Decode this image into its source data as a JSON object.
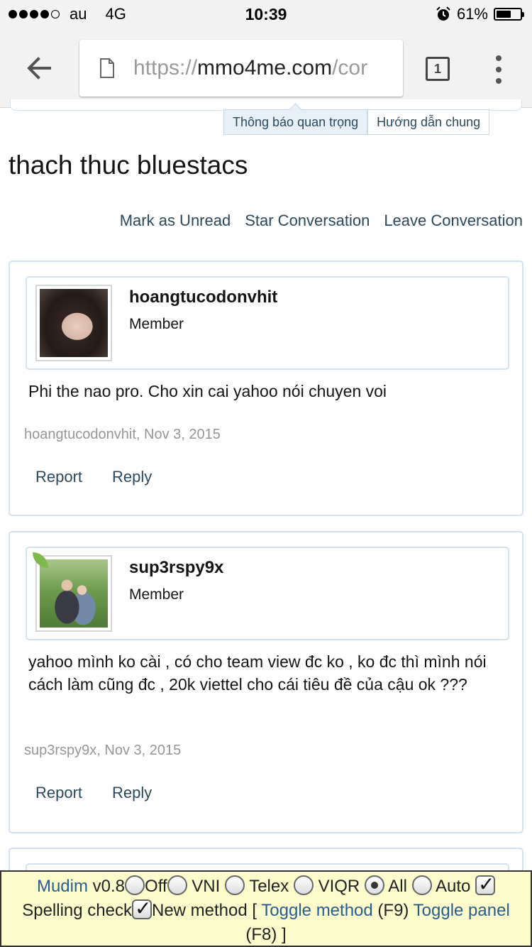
{
  "status_bar": {
    "carrier": "au",
    "network": "4G",
    "time": "10:39",
    "battery": "61%",
    "battery_level": 0.61
  },
  "browser": {
    "url_scheme": "https://",
    "url_domain": "mmo4me.com",
    "url_rest": "/cor",
    "tab_count": "1"
  },
  "subtabs": [
    "Thông báo quan trọng",
    "Hướng dẫn chung"
  ],
  "conversation": {
    "title": "thach thuc bluestacs",
    "actions": [
      "Mark as Unread",
      "Star Conversation",
      "Leave Conversation"
    ]
  },
  "messages": [
    {
      "username": "hoangtucodonvhit",
      "user_title": "Member",
      "text": "Phi the nao pro. Cho xin cai yahoo nói chuyen voi",
      "meta": "hoangtucodonvhit, Nov 3, 2015",
      "report": "Report",
      "reply": "Reply"
    },
    {
      "username": "sup3rspy9x",
      "user_title": "Member",
      "text": "yahoo mình ko cài , có cho team view đc ko , ko đc thì mình nói cách làm cũng đc , 20k viettel cho cái tiêu đề của cậu ok ???",
      "meta": "sup3rspy9x, Nov 3, 2015",
      "report": "Report",
      "reply": "Reply"
    }
  ],
  "mudim": {
    "name": "Mudim",
    "version": "v0.8",
    "options": [
      "Off",
      "VNI",
      "Telex",
      "VIQR",
      "All",
      "Auto"
    ],
    "selected": "All",
    "spelling_check": "Spelling check",
    "new_method": "New method",
    "bracket_open": "[",
    "toggle_method": "Toggle method",
    "toggle_method_key": "(F9)",
    "toggle_panel": "Toggle panel",
    "toggle_panel_key": "(F8)",
    "bracket_close": "]"
  },
  "colors": {
    "link": "#2b485c",
    "border": "#d5e2ef",
    "meta": "#969696",
    "mudim_bg": "#fbfbcc"
  }
}
